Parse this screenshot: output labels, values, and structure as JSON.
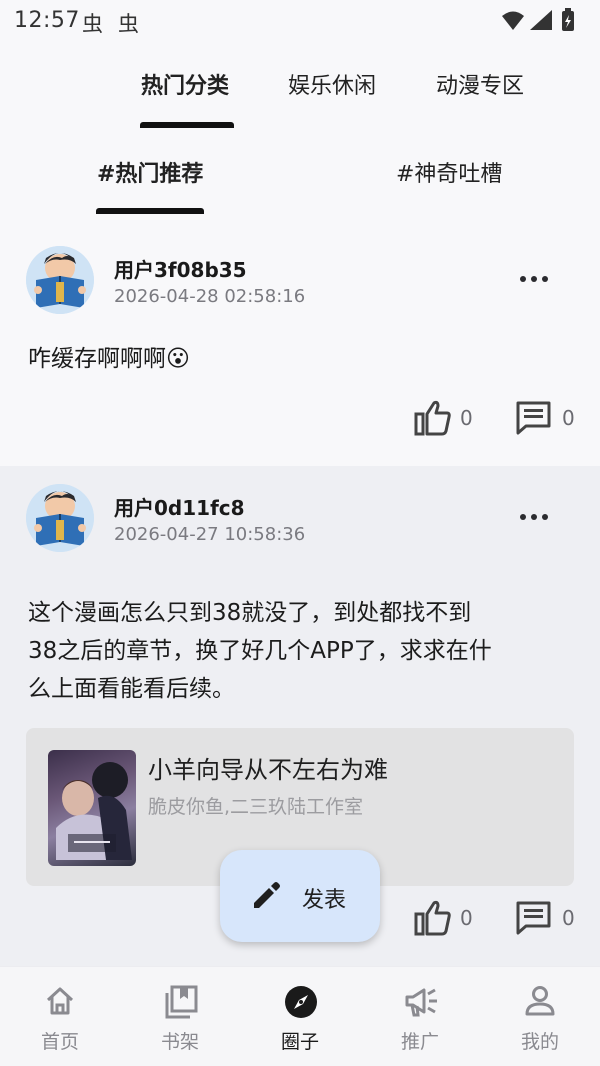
{
  "status_bar": {
    "time": "12:57",
    "notif1": "虫",
    "notif2": "虫"
  },
  "category_tabs": [
    {
      "label": "热门分类",
      "active": true
    },
    {
      "label": "娱乐休闲",
      "active": false
    },
    {
      "label": "动漫专区",
      "active": false
    }
  ],
  "sub_tabs": [
    {
      "label": "#热门推荐",
      "active": true
    },
    {
      "label": "#神奇吐槽",
      "active": false
    }
  ],
  "posts": [
    {
      "username": "用户3f08b35",
      "time": "2026-04-28 02:58:16",
      "text": "咋缓存啊啊啊",
      "emoji": "😮",
      "likes": "0",
      "comments": "0"
    },
    {
      "username": "用户0d11fc8",
      "time": "2026-04-27 10:58:36",
      "text_lines": [
        "这个漫画怎么只到38就没了，到处都找不到",
        "38之后的章节，换了好几个APP了，求求在什",
        "么上面看能看后续。"
      ],
      "book": {
        "title": "小羊向导从不左右为难",
        "author": "脆皮你鱼,二三玖陆工作室"
      },
      "likes": "0",
      "comments": "0"
    }
  ],
  "fab": {
    "label": "发表"
  },
  "bottom_nav": [
    {
      "label": "首页",
      "icon": "home-icon",
      "active": false
    },
    {
      "label": "书架",
      "icon": "bookshelf-icon",
      "active": false
    },
    {
      "label": "圈子",
      "icon": "compass-icon",
      "active": true
    },
    {
      "label": "推广",
      "icon": "megaphone-icon",
      "active": false
    },
    {
      "label": "我的",
      "icon": "profile-icon",
      "active": false
    }
  ],
  "colors": {
    "active_indicator": "#111111",
    "fab_bg": "#d7e6fb",
    "post_alt_bg": "#eeeff3"
  }
}
